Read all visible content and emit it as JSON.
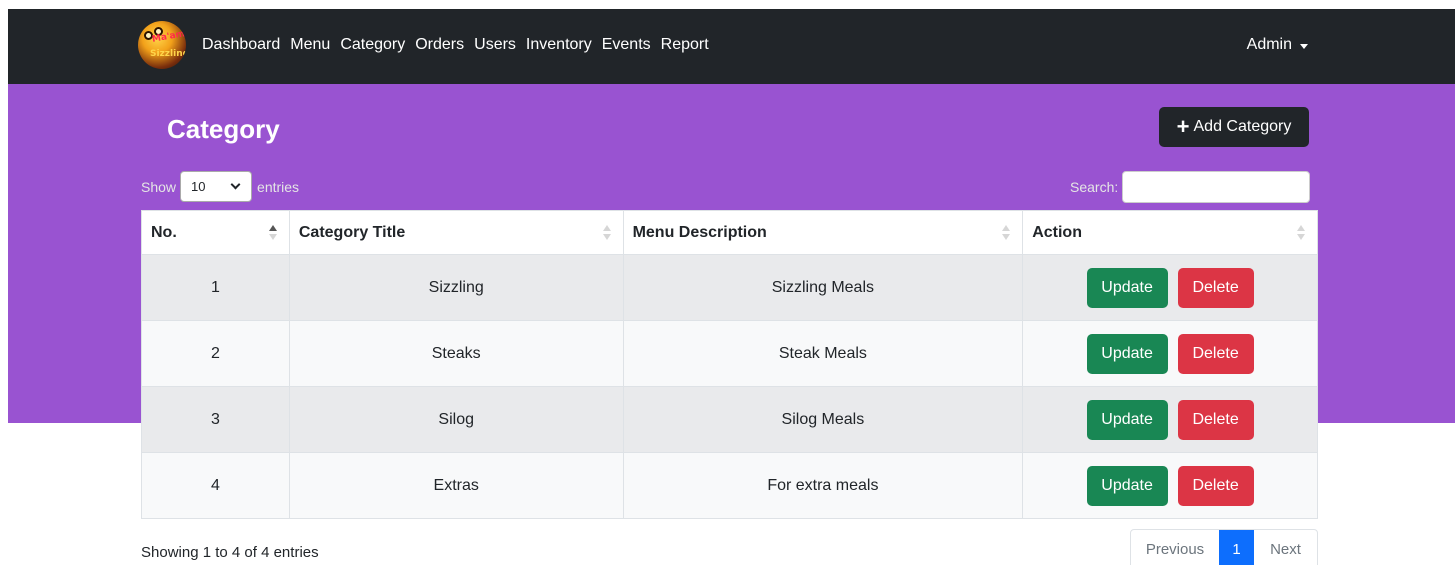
{
  "navbar": {
    "logo_text_top": "Ma'am",
    "logo_text_bottom": "Sizzling",
    "links": [
      "Dashboard",
      "Menu",
      "Category",
      "Orders",
      "Users",
      "Inventory",
      "Events",
      "Report"
    ],
    "user_menu": "Admin"
  },
  "header": {
    "title": "Category",
    "add_button": "Add Category"
  },
  "controls": {
    "show_label": "Show",
    "entries_value": "10",
    "entries_label": "entries",
    "search_label": "Search:",
    "search_value": ""
  },
  "table": {
    "columns": [
      "No.",
      "Category Title",
      "Menu Description",
      "Action"
    ],
    "rows": [
      {
        "no": "1",
        "title": "Sizzling",
        "description": "Sizzling Meals"
      },
      {
        "no": "2",
        "title": "Steaks",
        "description": "Steak Meals"
      },
      {
        "no": "3",
        "title": "Silog",
        "description": "Silog Meals"
      },
      {
        "no": "4",
        "title": "Extras",
        "description": "For extra meals"
      }
    ],
    "update_label": "Update",
    "delete_label": "Delete"
  },
  "footer": {
    "info": "Showing 1 to 4 of 4 entries",
    "prev": "Previous",
    "page": "1",
    "next": "Next"
  },
  "colors": {
    "navbar": "#212529",
    "banner": "#9953d1",
    "update": "#198754",
    "delete": "#dc3545",
    "page_active": "#0d6efd"
  }
}
